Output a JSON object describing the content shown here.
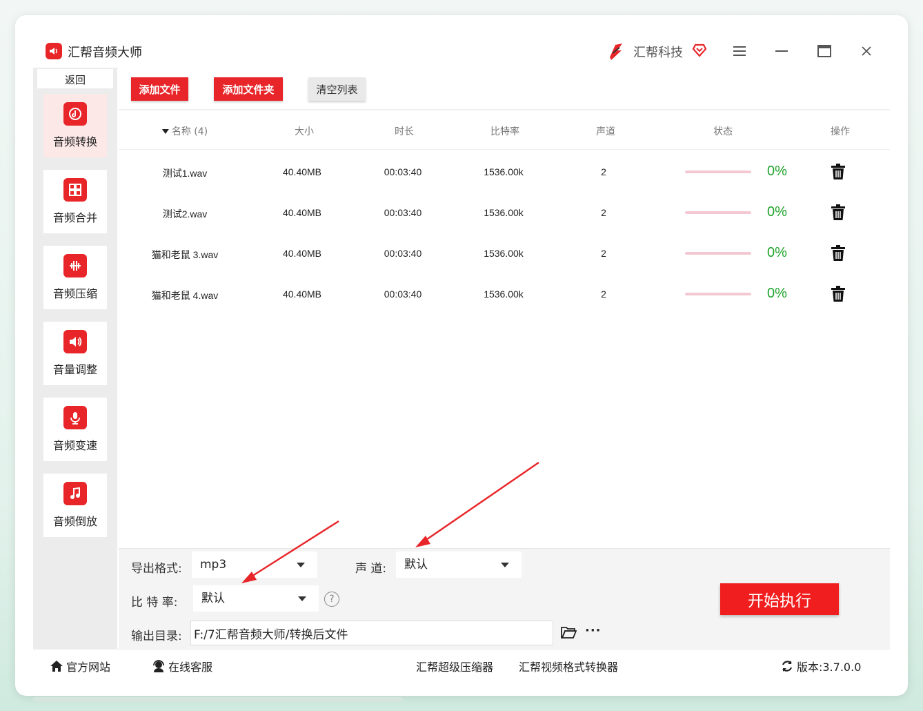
{
  "app": {
    "title": "汇帮音频大师",
    "brand": "汇帮科技"
  },
  "sidebar": {
    "back": "返回",
    "items": [
      {
        "label": "音频转换",
        "icon": "convert-icon"
      },
      {
        "label": "音频合并",
        "icon": "merge-icon"
      },
      {
        "label": "音频压缩",
        "icon": "compress-icon"
      },
      {
        "label": "音量调整",
        "icon": "volume-icon"
      },
      {
        "label": "音频变速",
        "icon": "speed-icon"
      },
      {
        "label": "音频倒放",
        "icon": "reverse-icon"
      }
    ]
  },
  "toolbar": {
    "add_file": "添加文件",
    "add_folder": "添加文件夹",
    "clear_list": "清空列表"
  },
  "table": {
    "headers": {
      "name": "名称 (4)",
      "size": "大小",
      "duration": "时长",
      "bitrate": "比特率",
      "channels": "声道",
      "status": "状态",
      "action": "操作"
    },
    "rows": [
      {
        "name": "测试1.wav",
        "size": "40.40MB",
        "duration": "00:03:40",
        "bitrate": "1536.00k",
        "channels": "2",
        "progress": 0,
        "status": "0%"
      },
      {
        "name": "测试2.wav",
        "size": "40.40MB",
        "duration": "00:03:40",
        "bitrate": "1536.00k",
        "channels": "2",
        "progress": 0,
        "status": "0%"
      },
      {
        "name": "猫和老鼠 3.wav",
        "size": "40.40MB",
        "duration": "00:03:40",
        "bitrate": "1536.00k",
        "channels": "2",
        "progress": 0,
        "status": "0%"
      },
      {
        "name": "猫和老鼠 4.wav",
        "size": "40.40MB",
        "duration": "00:03:40",
        "bitrate": "1536.00k",
        "channels": "2",
        "progress": 0,
        "status": "0%"
      }
    ]
  },
  "settings": {
    "format_label": "导出格式:",
    "format_value": "mp3",
    "channel_label": "声 道:",
    "channel_value": "默认",
    "bitrate_label": "比 特 率:",
    "bitrate_value": "默认",
    "help": "?",
    "output_label": "输出目录:",
    "output_path": "F:/7汇帮音频大师/转换后文件",
    "more": "···",
    "start": "开始执行"
  },
  "footer": {
    "website": "官方网站",
    "service": "在线客服",
    "link1": "汇帮超级压缩器",
    "link2": "汇帮视频格式转换器",
    "version": "版本:3.7.0.0"
  },
  "colors": {
    "accent": "#e8262a",
    "progress_bg": "#f4c8d2",
    "percent": "#1fa32a",
    "annotation": "#e8262a"
  }
}
